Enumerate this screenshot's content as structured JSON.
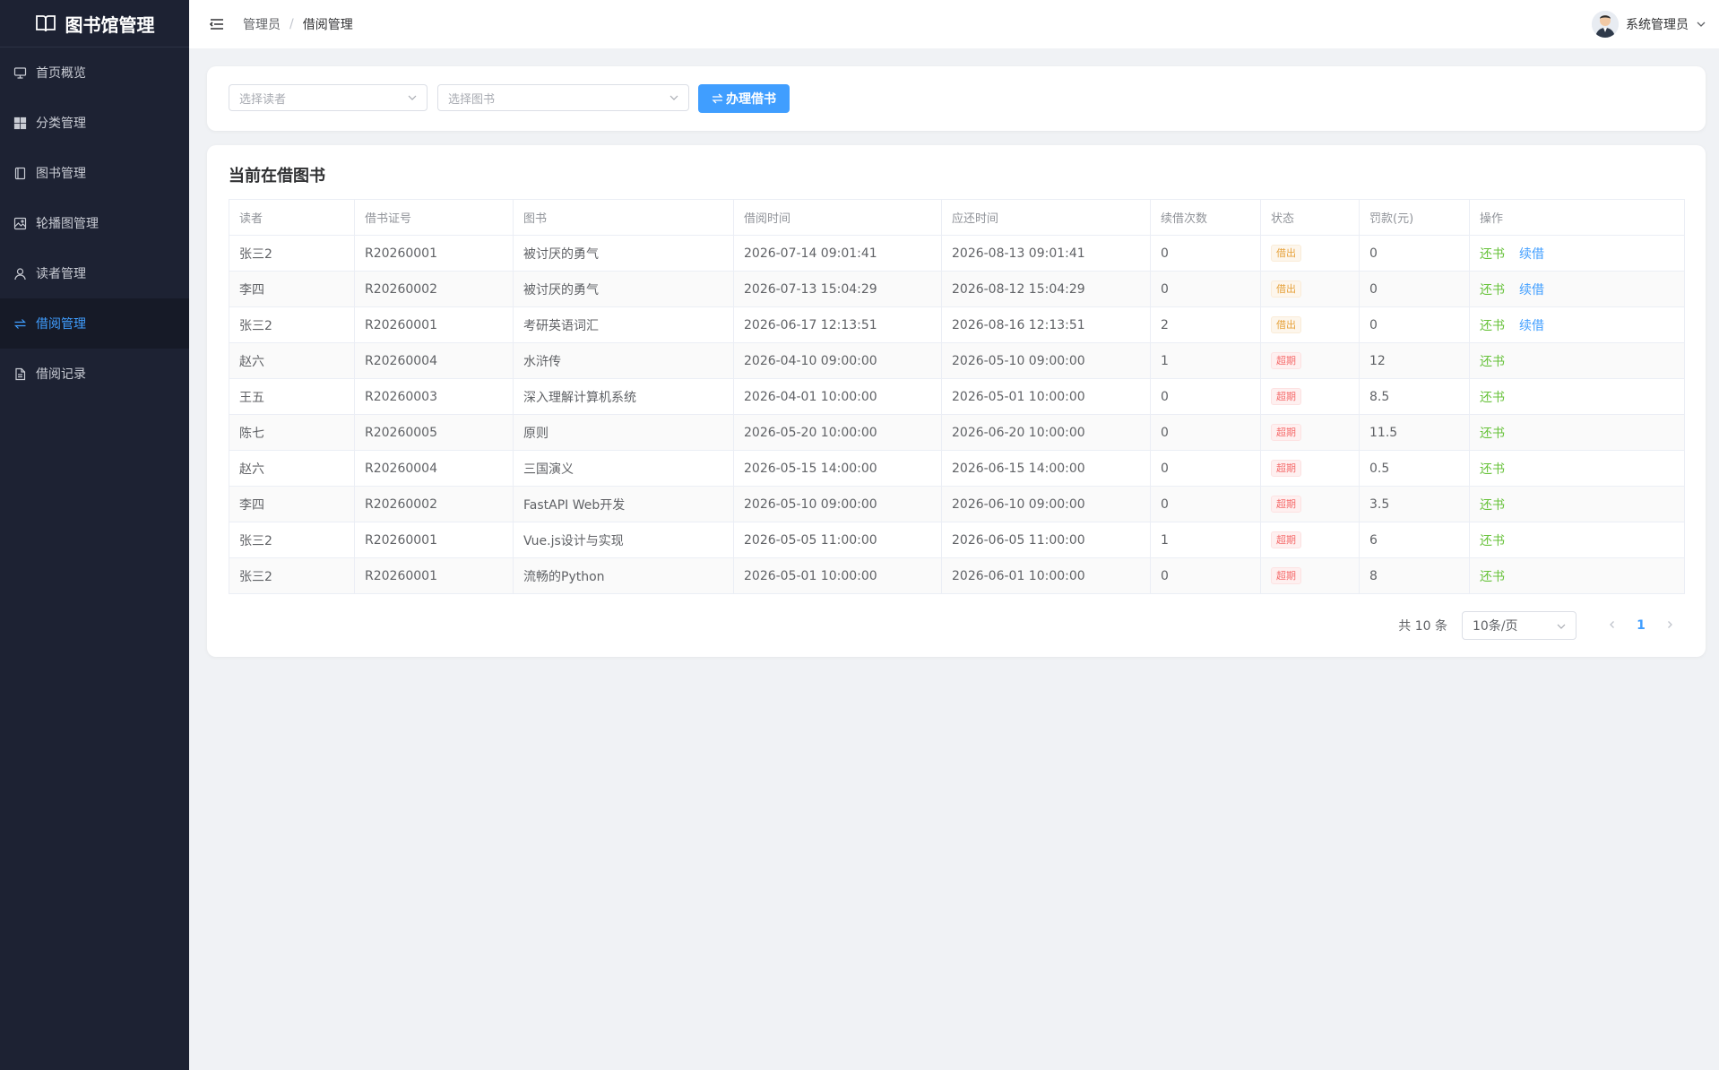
{
  "app": {
    "title": "图书馆管理"
  },
  "sidebar": {
    "items": [
      {
        "label": "首页概览",
        "icon": "dashboard-icon",
        "active": false
      },
      {
        "label": "分类管理",
        "icon": "grid-icon",
        "active": false
      },
      {
        "label": "图书管理",
        "icon": "book-icon",
        "active": false
      },
      {
        "label": "轮播图管理",
        "icon": "image-icon",
        "active": false
      },
      {
        "label": "读者管理",
        "icon": "user-icon",
        "active": false
      },
      {
        "label": "借阅管理",
        "icon": "swap-icon",
        "active": true
      },
      {
        "label": "借阅记录",
        "icon": "document-icon",
        "active": false
      }
    ]
  },
  "header": {
    "breadcrumb": [
      "管理员",
      "借阅管理"
    ],
    "user_name": "系统管理员"
  },
  "toolbar": {
    "reader_placeholder": "选择读者",
    "book_placeholder": "选择图书",
    "borrow_button": "办理借书"
  },
  "main": {
    "title": "当前在借图书",
    "columns": [
      "读者",
      "借书证号",
      "图书",
      "借阅时间",
      "应还时间",
      "续借次数",
      "状态",
      "罚款(元)",
      "操作"
    ],
    "rows": [
      {
        "reader": "张三2",
        "card": "R20260001",
        "book": "被讨厌的勇气",
        "borrow_time": "2026-07-14 09:01:41",
        "due_time": "2026-08-13 09:01:41",
        "renewals": "0",
        "status": "借出",
        "status_type": "borrowed",
        "fine": "0",
        "actions": [
          "还书",
          "续借"
        ]
      },
      {
        "reader": "李四",
        "card": "R20260002",
        "book": "被讨厌的勇气",
        "borrow_time": "2026-07-13 15:04:29",
        "due_time": "2026-08-12 15:04:29",
        "renewals": "0",
        "status": "借出",
        "status_type": "borrowed",
        "fine": "0",
        "actions": [
          "还书",
          "续借"
        ]
      },
      {
        "reader": "张三2",
        "card": "R20260001",
        "book": "考研英语词汇",
        "borrow_time": "2026-06-17 12:13:51",
        "due_time": "2026-08-16 12:13:51",
        "renewals": "2",
        "status": "借出",
        "status_type": "borrowed",
        "fine": "0",
        "actions": [
          "还书",
          "续借"
        ]
      },
      {
        "reader": "赵六",
        "card": "R20260004",
        "book": "水浒传",
        "borrow_time": "2026-04-10 09:00:00",
        "due_time": "2026-05-10 09:00:00",
        "renewals": "1",
        "status": "超期",
        "status_type": "overdue",
        "fine": "12",
        "actions": [
          "还书"
        ]
      },
      {
        "reader": "王五",
        "card": "R20260003",
        "book": "深入理解计算机系统",
        "borrow_time": "2026-04-01 10:00:00",
        "due_time": "2026-05-01 10:00:00",
        "renewals": "0",
        "status": "超期",
        "status_type": "overdue",
        "fine": "8.5",
        "actions": [
          "还书"
        ]
      },
      {
        "reader": "陈七",
        "card": "R20260005",
        "book": "原则",
        "borrow_time": "2026-05-20 10:00:00",
        "due_time": "2026-06-20 10:00:00",
        "renewals": "0",
        "status": "超期",
        "status_type": "overdue",
        "fine": "11.5",
        "actions": [
          "还书"
        ]
      },
      {
        "reader": "赵六",
        "card": "R20260004",
        "book": "三国演义",
        "borrow_time": "2026-05-15 14:00:00",
        "due_time": "2026-06-15 14:00:00",
        "renewals": "0",
        "status": "超期",
        "status_type": "overdue",
        "fine": "0.5",
        "actions": [
          "还书"
        ]
      },
      {
        "reader": "李四",
        "card": "R20260002",
        "book": "FastAPI Web开发",
        "borrow_time": "2026-05-10 09:00:00",
        "due_time": "2026-06-10 09:00:00",
        "renewals": "0",
        "status": "超期",
        "status_type": "overdue",
        "fine": "3.5",
        "actions": [
          "还书"
        ]
      },
      {
        "reader": "张三2",
        "card": "R20260001",
        "book": "Vue.js设计与实现",
        "borrow_time": "2026-05-05 11:00:00",
        "due_time": "2026-06-05 11:00:00",
        "renewals": "1",
        "status": "超期",
        "status_type": "overdue",
        "fine": "6",
        "actions": [
          "还书"
        ]
      },
      {
        "reader": "张三2",
        "card": "R20260001",
        "book": "流畅的Python",
        "borrow_time": "2026-05-01 10:00:00",
        "due_time": "2026-06-01 10:00:00",
        "renewals": "0",
        "status": "超期",
        "status_type": "overdue",
        "fine": "8",
        "actions": [
          "还书"
        ]
      }
    ]
  },
  "pagination": {
    "total_text": "共 10 条",
    "page_size": "10条/页",
    "current_page": "1"
  },
  "colors": {
    "sidebar_bg": "#1d2233",
    "accent": "#409eff",
    "return_link": "#67c23a",
    "borrowed_tag": "#e6a23c",
    "overdue_tag": "#f56c6c"
  }
}
